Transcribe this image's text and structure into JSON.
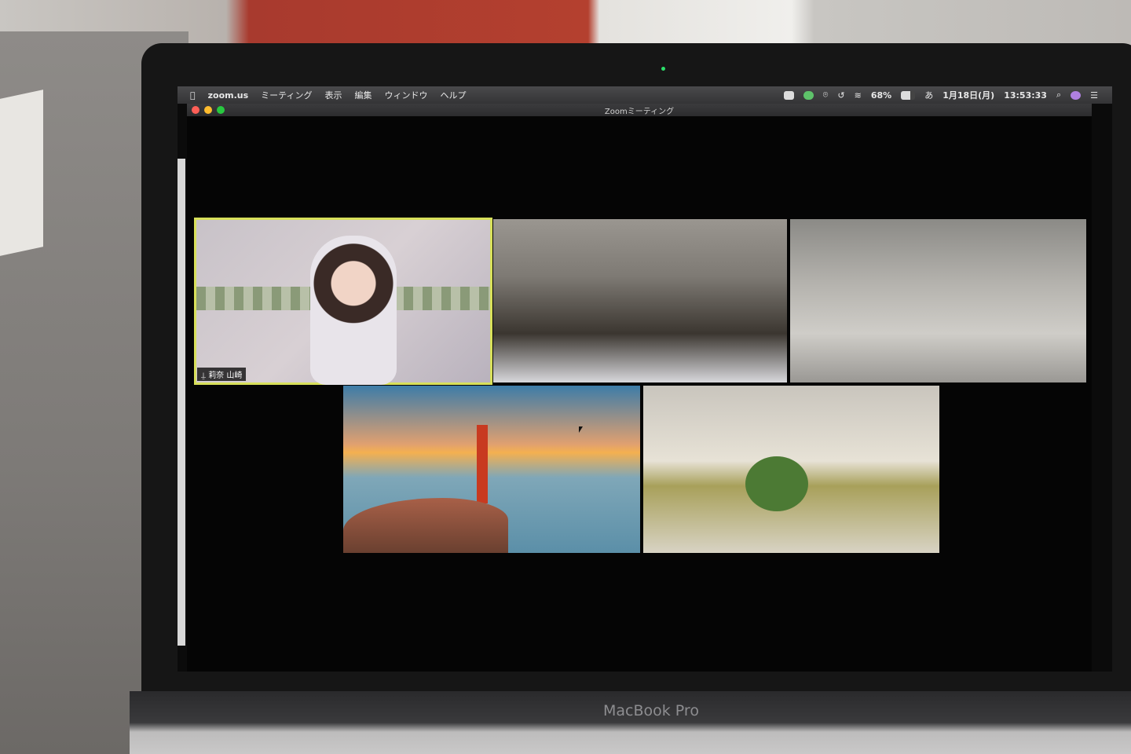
{
  "menubar": {
    "app": "zoom.us",
    "items": [
      "ミーティング",
      "表示",
      "編集",
      "ウィンドウ",
      "ヘルプ"
    ],
    "battery": "68%",
    "input_method": "あ",
    "date": "1月18日(月)",
    "time": "13:53:33"
  },
  "window": {
    "title": "Zoomミーティング"
  },
  "participants": [
    {
      "name": "莉奈 山崎",
      "active_speaker": true
    }
  ],
  "device": {
    "brand": "MacBook Pro"
  },
  "colors": {
    "active_border": "#d8e05a",
    "close": "#ff5f57",
    "minimize": "#febc2e",
    "zoom": "#28c840"
  }
}
